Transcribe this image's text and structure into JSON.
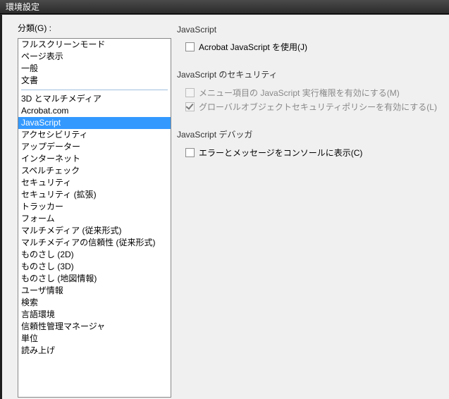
{
  "window": {
    "title": "環境設定"
  },
  "sidebar": {
    "label": "分類(G) :",
    "group1": [
      "フルスクリーンモード",
      "ページ表示",
      "一般",
      "文書"
    ],
    "group2": [
      "3D とマルチメディア",
      "Acrobat.com",
      "JavaScript",
      "アクセシビリティ",
      "アップデーター",
      "インターネット",
      "スペルチェック",
      "セキュリティ",
      "セキュリティ (拡張)",
      "トラッカー",
      "フォーム",
      "マルチメディア (従来形式)",
      "マルチメディアの信頼性 (従来形式)",
      "ものさし (2D)",
      "ものさし (3D)",
      "ものさし (地図情報)",
      "ユーザ情報",
      "検索",
      "言語環境",
      "信頼性管理マネージャ",
      "単位",
      "読み上げ"
    ],
    "selected": "JavaScript"
  },
  "panels": {
    "js": {
      "title": "JavaScript",
      "enable_label": "Acrobat JavaScript を使用(J)",
      "enable_checked": false
    },
    "security": {
      "title": "JavaScript のセキュリティ",
      "menu_label": "メニュー項目の JavaScript 実行権限を有効にする(M)",
      "menu_checked": false,
      "global_label": "グローバルオブジェクトセキュリティポリシーを有効にする(L)",
      "global_checked": true
    },
    "debugger": {
      "title": "JavaScript デバッガ",
      "console_label": "エラーとメッセージをコンソールに表示(C)",
      "console_checked": false
    }
  }
}
